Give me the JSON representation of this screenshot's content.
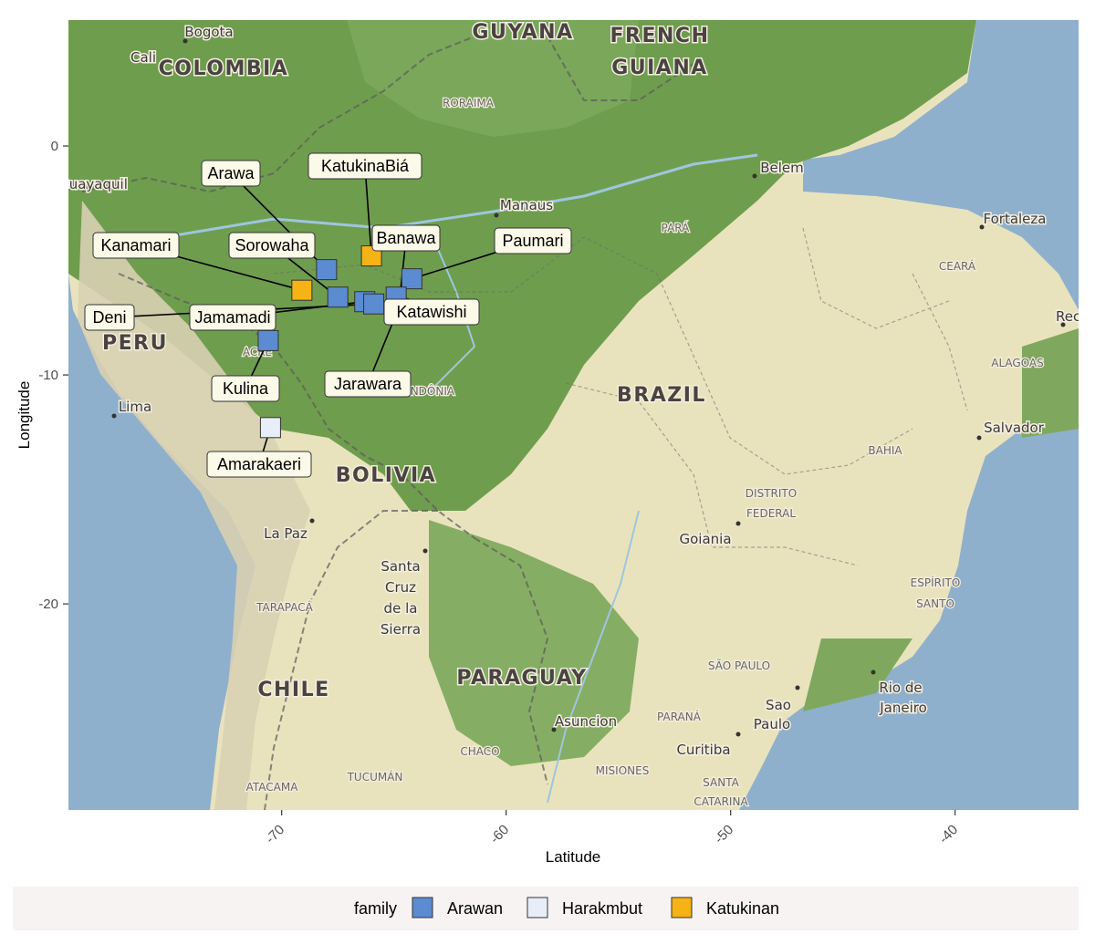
{
  "x_axis": {
    "title": "Latitude",
    "ticks": [
      {
        "value": -70,
        "label": "-70"
      },
      {
        "value": -60,
        "label": "-60"
      },
      {
        "value": -50,
        "label": "-50"
      },
      {
        "value": -40,
        "label": "-40"
      }
    ]
  },
  "y_axis": {
    "title": "Longitude",
    "ticks": [
      {
        "value": 0,
        "label": "0"
      },
      {
        "value": -10,
        "label": "-10"
      },
      {
        "value": -20,
        "label": "-20"
      }
    ]
  },
  "legend": {
    "title": "family",
    "placement": "bottom",
    "items": [
      {
        "name": "Arawan",
        "color": "#5b8bd0"
      },
      {
        "name": "Harakmbut",
        "color": "#e8eef8"
      },
      {
        "name": "Katukinan",
        "color": "#f5b316"
      }
    ]
  },
  "map_labels": {
    "countries": [
      "COLOMBIA",
      "GUYANA",
      "FRENCH",
      "GUIANA",
      "PERU",
      "BRAZIL",
      "BOLIVIA",
      "PARAGUAY",
      "CHILE"
    ],
    "regions": [
      "RORAIMA",
      "PARÁ",
      "CEARÁ",
      "ALAGOAS",
      "BAHIA",
      "DISTRITO",
      "FEDERAL",
      "ESPÍRITO",
      "SANTO",
      "ACRE",
      "RONDÔNIA",
      "TARAPACÁ",
      "SÃO PAULO",
      "PARANÁ",
      "CHACO",
      "MISIONES",
      "SANTA",
      "CATARINA",
      "ATACAMA",
      "TUCUMÁN"
    ],
    "cities": [
      "Bogota",
      "Cali",
      "Guayaquil",
      "Manaus",
      "Belem",
      "Fortaleza",
      "Recife",
      "Salvador",
      "Lima",
      "La Paz",
      "Santa",
      "Cruz",
      "de la",
      "Sierra",
      "Goiania",
      "Rio de",
      "Janeiro",
      "Sao",
      "Paulo",
      "Curitiba",
      "Asuncion"
    ]
  },
  "chart_data": {
    "type": "scatter",
    "title": "",
    "xlabel": "Latitude",
    "ylabel": "Longitude",
    "xlim": [
      -79.5,
      -34.5
    ],
    "ylim": [
      -29.0,
      5.5
    ],
    "grid": false,
    "legend_placement": "bottom",
    "series": [
      {
        "name": "Arawan",
        "color": "#5b8bd0",
        "points": [
          {
            "label": "Arawa",
            "x": -68.0,
            "y": -5.4
          },
          {
            "label": "Sorowaha",
            "x": -67.5,
            "y": -6.6
          },
          {
            "label": "Jamamadi",
            "x": -66.3,
            "y": -6.8
          },
          {
            "label": "Deni",
            "x": -65.9,
            "y": -6.9
          },
          {
            "label": "Paumari",
            "x": -64.2,
            "y": -5.8
          },
          {
            "label": "Jarawara",
            "x": -64.8,
            "y": -7.1
          },
          {
            "label": "Katawishi",
            "x": -64.9,
            "y": -6.6
          },
          {
            "label": "Kulina",
            "x": -70.6,
            "y": -8.5
          }
        ]
      },
      {
        "name": "Harakmbut",
        "color": "#e8eef8",
        "points": [
          {
            "label": "Amarakaeri",
            "x": -70.5,
            "y": -12.3
          }
        ]
      },
      {
        "name": "Katukinan",
        "color": "#f5b316",
        "points": [
          {
            "label": "Kanamari",
            "x": -69.1,
            "y": -6.3
          },
          {
            "label": "KatukinaBiá",
            "x": -66.0,
            "y": -4.8
          },
          {
            "label": "Banawa",
            "x": -64.8,
            "y": -7.2
          }
        ]
      }
    ]
  }
}
